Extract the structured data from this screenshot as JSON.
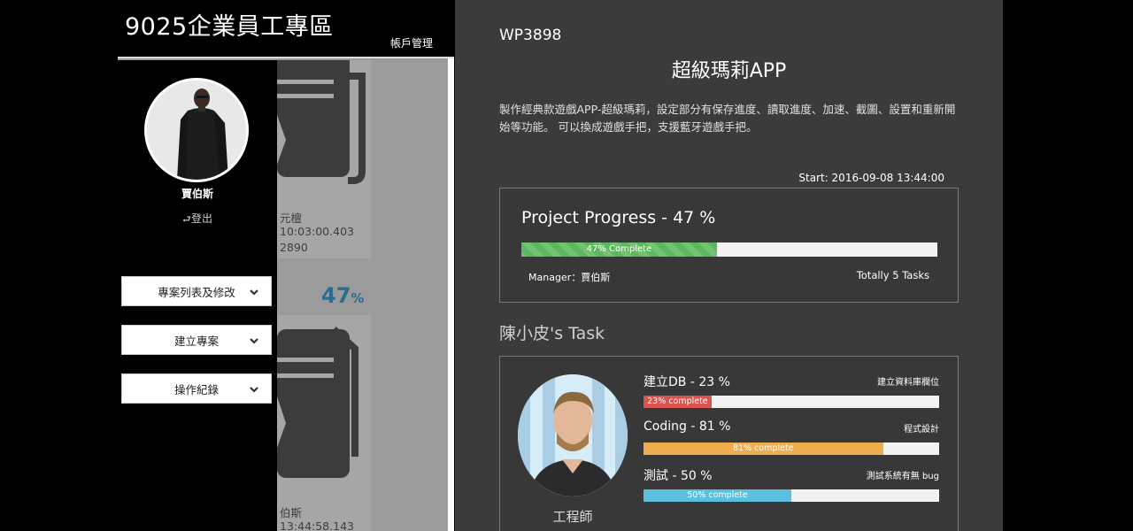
{
  "app": {
    "brand": "9025企業員工專區",
    "account_link": "帳戶管理"
  },
  "sidebar": {
    "user_name": "賈伯斯",
    "logout_label": "登出",
    "menu": [
      {
        "label": "專案列表及修改",
        "icon": "chevron-down-icon"
      },
      {
        "label": "建立專案",
        "icon": "chevron-down-icon"
      },
      {
        "label": "操作紀錄",
        "icon": "chevron-down-icon"
      }
    ]
  },
  "background_cards": {
    "card1_line1": "元檀",
    "card1_line2": "10:03:00.403",
    "card1_line3": "2890",
    "percent_value": "47",
    "percent_unit": "%",
    "card2_line1": "伯斯",
    "card2_line2": "13:44:58.143"
  },
  "project": {
    "code": "WP3898",
    "title": "超級瑪莉APP",
    "description": "製作經典款遊戲APP-超級瑪莉，設定部分有保存進度、讀取進度、加速、截圖、設置和重新開始等功能。 可以換成遊戲手把，支援藍牙遊戲手把。",
    "start": "Start: 2016-09-08 13:44:00",
    "progress_title": "Project Progress - 47 %",
    "progress_value": 0.47,
    "progress_label": "47% Complete",
    "manager": "Manager：賈伯斯",
    "total_tasks": "Totally 5 Tasks"
  },
  "task_section": {
    "heading": "陳小皮's Task",
    "role": "工程師",
    "tasks": [
      {
        "title": "建立DB - 23 %",
        "note": "建立資料庫欄位",
        "value": 0.23,
        "label": "23% complete",
        "color": "#d9534f"
      },
      {
        "title": "Coding - 81 %",
        "note": "程式設計",
        "value": 0.81,
        "label": "81% complete",
        "color": "#f0ad4e"
      },
      {
        "title": "測試 - 50 %",
        "note": "測試系統有無 bug",
        "value": 0.5,
        "label": "50% complete",
        "color": "#5bc0de"
      }
    ]
  },
  "colors": {
    "sidebar_bg": "#000000",
    "panel_bg": "#3b3b3b",
    "success": "#5cb85c",
    "danger": "#d9534f",
    "warning": "#f0ad4e",
    "info": "#5bc0de",
    "percent_text": "#2d6b8f"
  }
}
